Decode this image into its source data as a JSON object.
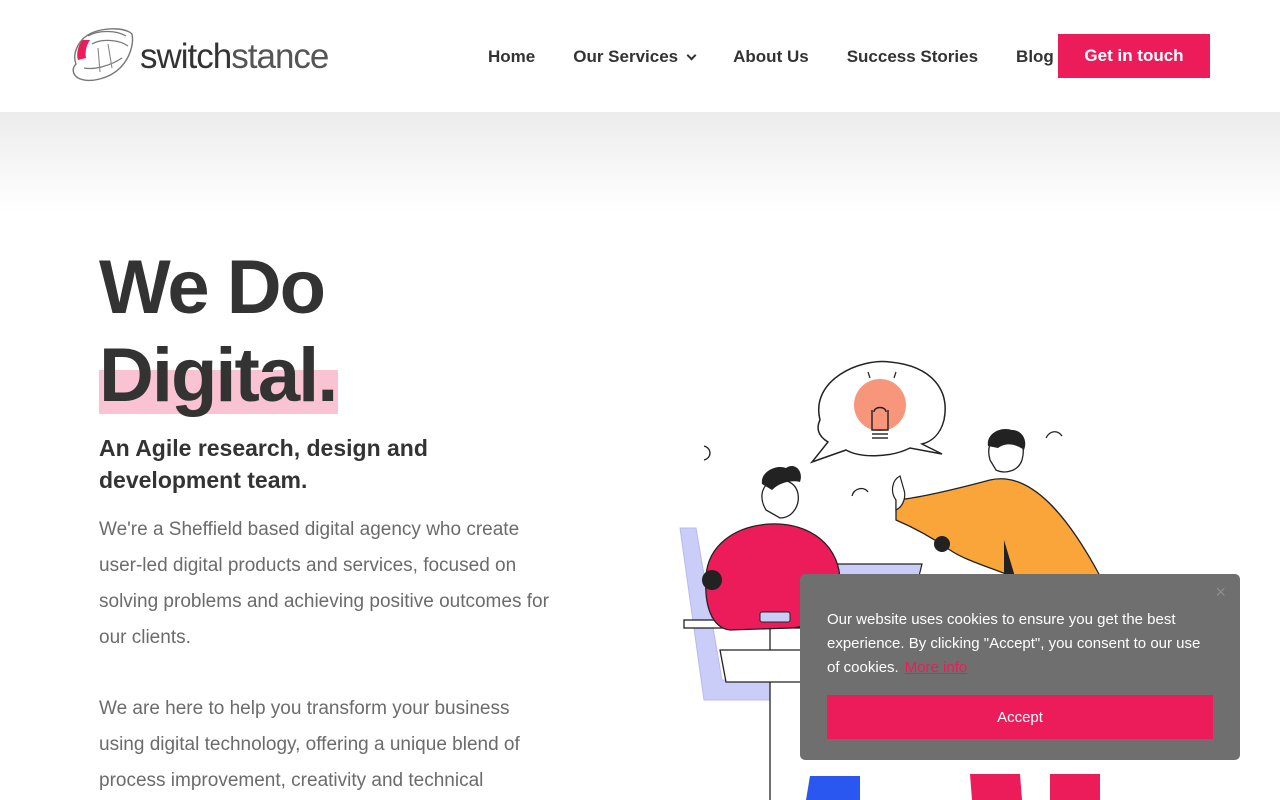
{
  "brand": {
    "logo_bold": "switch",
    "logo_thin": "stance",
    "accent_color": "#ec1c5a"
  },
  "nav": {
    "items": [
      {
        "label": "Home"
      },
      {
        "label": "Our Services",
        "has_dropdown": true
      },
      {
        "label": "About Us"
      },
      {
        "label": "Success Stories"
      },
      {
        "label": "Blog"
      }
    ],
    "cta_label": "Get in touch"
  },
  "hero": {
    "title_line1": "We Do",
    "title_line2": "Digital.",
    "subtitle": "An Agile research, design and development team.",
    "paragraph1": "We're a Sheffield based digital agency who create user-led digital products and services, focused on solving problems and achieving positive outcomes for our clients.",
    "paragraph2": "We are here to help you transform your business using digital technology, offering a unique blend of process improvement, creativity and technical"
  },
  "cookie_banner": {
    "close_icon": "×",
    "message": "Our website uses cookies to ensure you get the best experience. By clicking \"Accept\", you consent to our use of cookies.",
    "more_info_label": "More info",
    "accept_label": "Accept"
  }
}
